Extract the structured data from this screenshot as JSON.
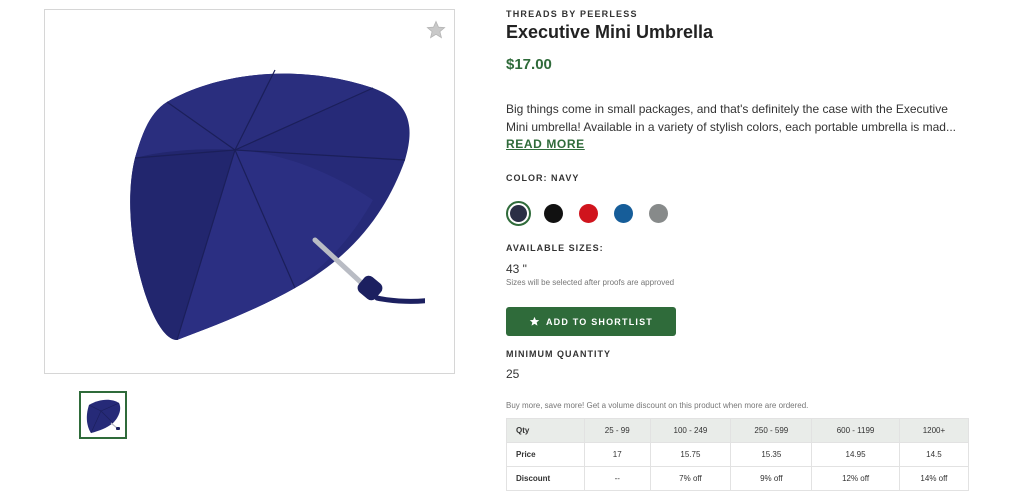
{
  "product": {
    "brand": "THREADS BY PEERLESS",
    "title": "Executive Mini Umbrella",
    "price": "$17.00",
    "description_lines": [
      "Big things come in small packages, and that's definitely the case with the Executive",
      "Mini umbrella! Available in a variety of stylish colors, each portable umbrella is mad..."
    ],
    "read_more": "READ MORE"
  },
  "images": {
    "main_icon": "umbrella-image",
    "favorite_icon": "star-icon",
    "thumbnail_icon": "umbrella-thumbnail"
  },
  "color": {
    "label": "COLOR: NAVY",
    "swatches": [
      {
        "name": "navy",
        "hex": "#2b2f45",
        "selected": true
      },
      {
        "name": "black",
        "hex": "#111111",
        "selected": false
      },
      {
        "name": "red",
        "hex": "#d0141d",
        "selected": false
      },
      {
        "name": "blue",
        "hex": "#165d99",
        "selected": false
      },
      {
        "name": "gray",
        "hex": "#878a8a",
        "selected": false
      }
    ]
  },
  "sizes": {
    "label": "AVAILABLE SIZES:",
    "value": "43 \"",
    "note": "Sizes will be selected after proofs are approved"
  },
  "shortlist": {
    "label": "ADD TO SHORTLIST",
    "icon": "star-icon"
  },
  "minimum_quantity": {
    "label": "MINIMUM QUANTITY",
    "value": "25"
  },
  "volume": {
    "note": "Buy more, save more! Get a volume discount on this product when more are ordered.",
    "headers": [
      "Qty",
      "25 - 99",
      "100 - 249",
      "250 - 599",
      "600 - 1199",
      "1200+"
    ],
    "rows": [
      [
        "Price",
        "17",
        "15.75",
        "15.35",
        "14.95",
        "14.5"
      ],
      [
        "Discount",
        "--",
        "7% off",
        "9% off",
        "12% off",
        "14% off"
      ]
    ]
  },
  "colors": {
    "accent": "#2f6b3a",
    "umbrella": "#262a78"
  }
}
